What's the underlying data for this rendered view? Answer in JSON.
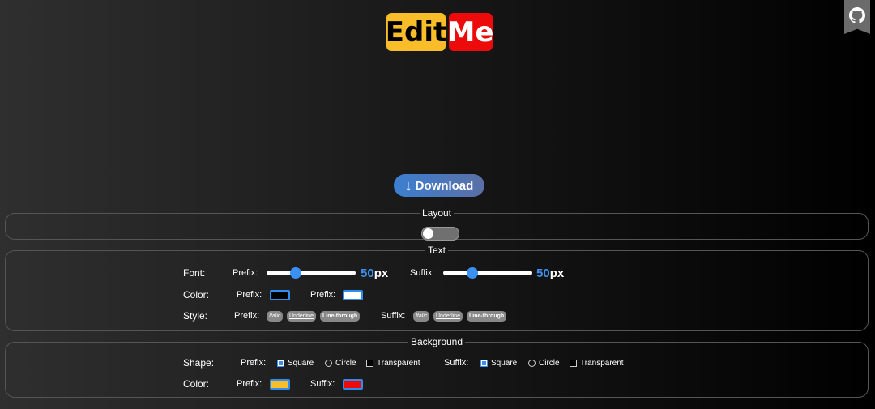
{
  "logo": {
    "prefix": "Edit",
    "suffix": "Me"
  },
  "download": {
    "label": "Download",
    "icon": "download-arrow-icon",
    "arrow": "↓"
  },
  "github": {
    "icon": "github-icon"
  },
  "layout": {
    "legend": "Layout",
    "toggle_on": false
  },
  "text": {
    "legend": "Text",
    "font": {
      "label": "Font:",
      "prefix_label": "Prefix:",
      "prefix_value": "50",
      "prefix_unit": "px",
      "suffix_label": "Suffix:",
      "suffix_value": "50",
      "suffix_unit": "px"
    },
    "color": {
      "label": "Color:",
      "prefix_label": "Prefix:",
      "prefix_color": "#000000",
      "suffix_label": "Prefix:",
      "suffix_color": "#ffffff"
    },
    "style": {
      "label": "Style:",
      "prefix_label": "Prefix:",
      "suffix_label": "Suffix:",
      "options": [
        "Italic",
        "Underline",
        "Line-through"
      ]
    }
  },
  "background": {
    "legend": "Background",
    "shape": {
      "label": "Shape:",
      "prefix_label": "Prefix:",
      "suffix_label": "Suffix:",
      "options": [
        "Square",
        "Circle",
        "Transparent"
      ],
      "prefix_selected": "Square",
      "suffix_selected": "Square"
    },
    "color": {
      "label": "Color:",
      "prefix_label": "Prefix:",
      "prefix_color": "#f9bd2a",
      "suffix_label": "Suffix:",
      "suffix_color": "#ec0a0a"
    }
  },
  "accent": "#3a91f2"
}
